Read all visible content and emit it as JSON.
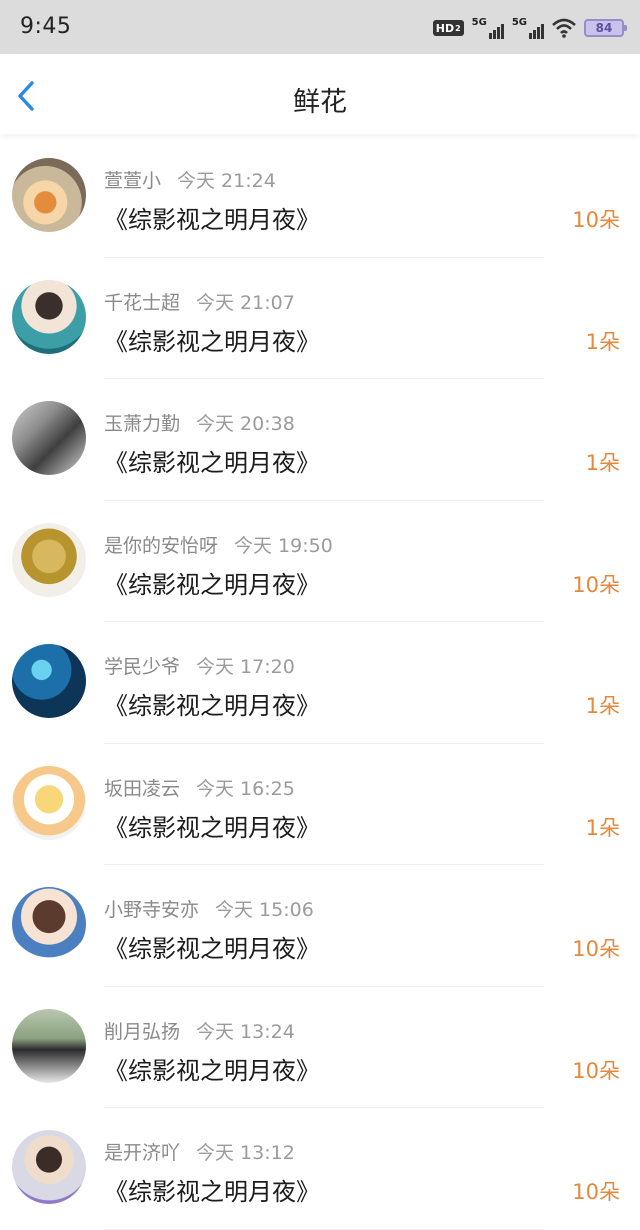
{
  "status": {
    "time": "9:45",
    "hd_label": "HD",
    "hd_sub": "2",
    "net1": "5G",
    "net2": "5G",
    "battery": "84"
  },
  "header": {
    "title": "鲜花",
    "back_icon": "chevron-left-icon"
  },
  "colors": {
    "accent_blue": "#2b8ae8",
    "count_orange": "#e8873a"
  },
  "list": [
    {
      "name": "萱萱小",
      "time": "今天 21:24",
      "book": "《综影视之明月夜》",
      "count": "10朵"
    },
    {
      "name": "千花士超",
      "time": "今天 21:07",
      "book": "《综影视之明月夜》",
      "count": "1朵"
    },
    {
      "name": "玉萧力勤",
      "time": "今天 20:38",
      "book": "《综影视之明月夜》",
      "count": "1朵"
    },
    {
      "name": "是你的安怡呀",
      "time": "今天 19:50",
      "book": "《综影视之明月夜》",
      "count": "10朵"
    },
    {
      "name": "学民少爷",
      "time": "今天 17:20",
      "book": "《综影视之明月夜》",
      "count": "1朵"
    },
    {
      "name": "坂田凌云",
      "time": "今天 16:25",
      "book": "《综影视之明月夜》",
      "count": "1朵"
    },
    {
      "name": "小野寺安亦",
      "time": "今天 15:06",
      "book": "《综影视之明月夜》",
      "count": "10朵"
    },
    {
      "name": "削月弘扬",
      "time": "今天 13:24",
      "book": "《综影视之明月夜》",
      "count": "10朵"
    },
    {
      "name": "是开济吖",
      "time": "今天 13:12",
      "book": "《综影视之明月夜》",
      "count": "10朵"
    }
  ]
}
